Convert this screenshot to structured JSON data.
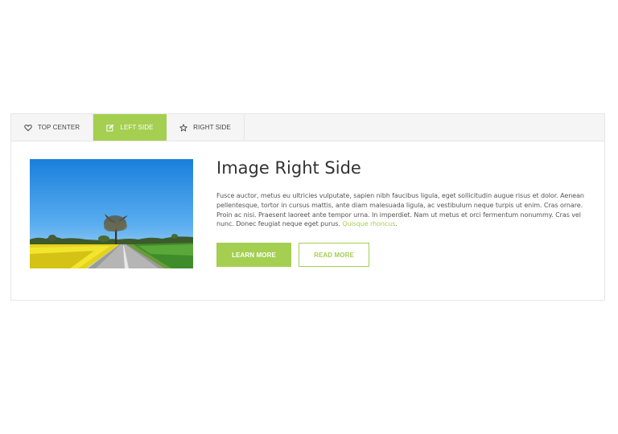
{
  "tabs": [
    {
      "label": "TOP CENTER",
      "icon": "heart-icon",
      "active": false
    },
    {
      "label": "LEFT SIDE",
      "icon": "edit-icon",
      "active": true
    },
    {
      "label": "RIGHT SIDE",
      "icon": "star-icon",
      "active": false
    }
  ],
  "content": {
    "image_alt": "Road through countryside with yellow rapeseed field and tree",
    "heading": "Image Right Side",
    "paragraph": "Fusce auctor, metus eu ultricies vulputate, sapien nibh faucibus ligula, eget sollicitudin augue risus et dolor. Aenean pellentesque, tortor in cursus mattis, ante diam malesuada ligula, ac vestibulum neque turpis ut enim. Cras ornare. Proin ac nisi. Praesent laoreet ante tempor urna. In imperdiet. Nam ut metus et orci fermentum nonummy. Cras vel nunc. Donec feugiat neque eget purus.",
    "link_text": "Quisque rhoncus",
    "link_suffix": ".",
    "learn_more_label": "LEARN MORE",
    "read_more_label": "READ MORE"
  },
  "colors": {
    "accent": "#a4cf51",
    "tabbar_bg": "#f5f5f5",
    "border": "#e6e6e6",
    "heading": "#333333",
    "text": "#555555"
  }
}
